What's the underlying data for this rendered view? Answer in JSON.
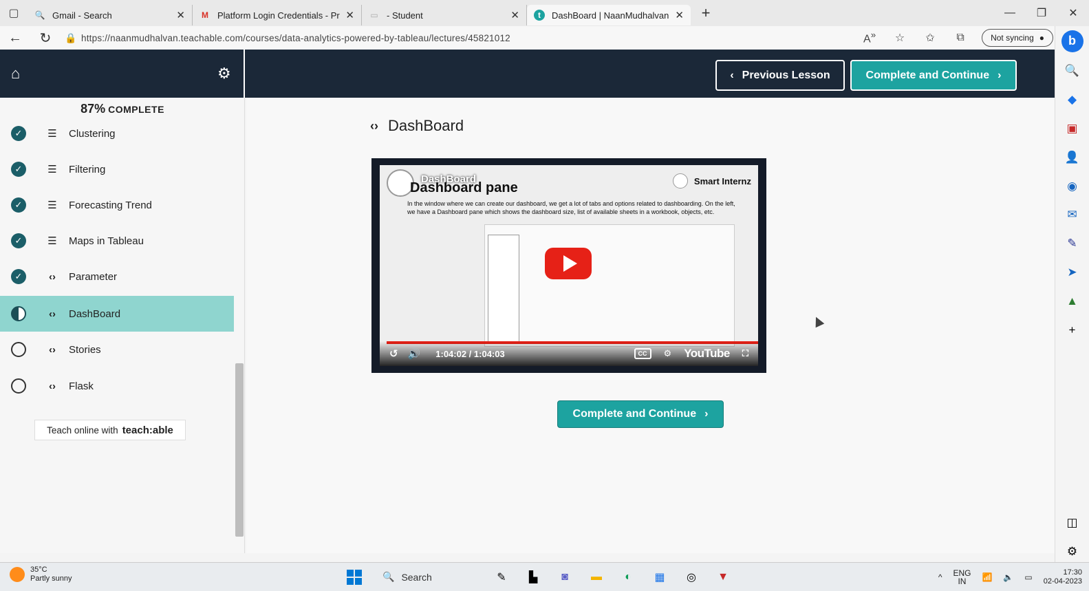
{
  "browser": {
    "tabs": [
      {
        "title": "Gmail - Search",
        "favicon": "search-icon",
        "active": false
      },
      {
        "title": "Platform Login Credentials - Pro",
        "favicon": "gmail-icon",
        "active": false
      },
      {
        "title": "- Student",
        "favicon": "page-icon",
        "active": false
      },
      {
        "title": "DashBoard | NaanMudhalvan",
        "favicon": "teachable-icon",
        "active": true
      }
    ],
    "url": "https://naanmudhalvan.teachable.com/courses/data-analytics-powered-by-tableau/lectures/45821012",
    "sync_label": "Not syncing"
  },
  "header": {
    "previous_label": "Previous Lesson",
    "complete_label": "Complete and Continue"
  },
  "sidebar": {
    "progress_pct": "87%",
    "progress_text": "COMPLETE",
    "lectures": [
      {
        "title": "Clustering",
        "type": "quiz",
        "status": "done"
      },
      {
        "title": "Filtering",
        "type": "quiz",
        "status": "done"
      },
      {
        "title": "Forecasting Trend",
        "type": "quiz",
        "status": "done"
      },
      {
        "title": "Maps in Tableau",
        "type": "quiz",
        "status": "done"
      },
      {
        "title": "Parameter",
        "type": "code",
        "status": "done"
      },
      {
        "title": "DashBoard",
        "type": "code",
        "status": "current"
      },
      {
        "title": "Stories",
        "type": "code",
        "status": "todo"
      },
      {
        "title": "Flask",
        "type": "code",
        "status": "todo"
      }
    ],
    "teach_text": "Teach online with",
    "teach_brand": "teach:able"
  },
  "main": {
    "lecture_title": "DashBoard",
    "video": {
      "channel_title": "DashBoard",
      "slide_title": "Dashboard pane",
      "description": "In the window where we can create our dashboard, we get a lot of tabs and options related to dashboarding. On the left, we have a Dashboard pane which shows the dashboard size, list of available sheets in a workbook, objects, etc.",
      "brand": "Smart Internz",
      "time": "1:04:02 / 1:04:03",
      "yt_label": "YouTube",
      "cc_label": "CC"
    },
    "complete_label": "Complete and Continue"
  },
  "taskbar": {
    "temperature": "35°C",
    "weather": "Partly sunny",
    "search_label": "Search",
    "lang": "ENG",
    "lang_sub": "IN",
    "time": "17:30",
    "date": "02-04-2023"
  },
  "colors": {
    "header_bg": "#1b2838",
    "accent": "#1da3a0",
    "current_row": "#8fd5cf",
    "done_check": "#1b5e68",
    "yt_red": "#e62117"
  }
}
